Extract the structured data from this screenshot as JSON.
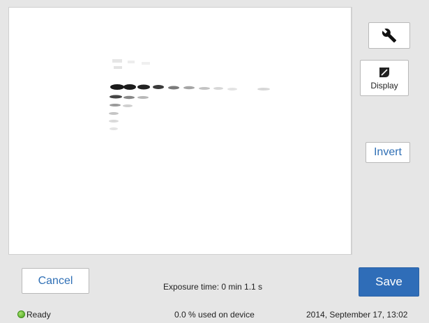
{
  "toolbar": {
    "tools_icon": "wrench-icon",
    "display_icon": "display-icon",
    "display_label": "Display",
    "invert_label": "Invert"
  },
  "footer": {
    "cancel_label": "Cancel",
    "save_label": "Save",
    "exposure_text": "Exposure time: 0 min 1.1 s",
    "status_text": "Ready",
    "usage_text": "0.0 % used on device",
    "datetime_text": "2014, September 17, 13:02"
  },
  "colors": {
    "accent": "#2f6db8",
    "background": "#e6e6e6",
    "status_ready": "#4aa320"
  }
}
